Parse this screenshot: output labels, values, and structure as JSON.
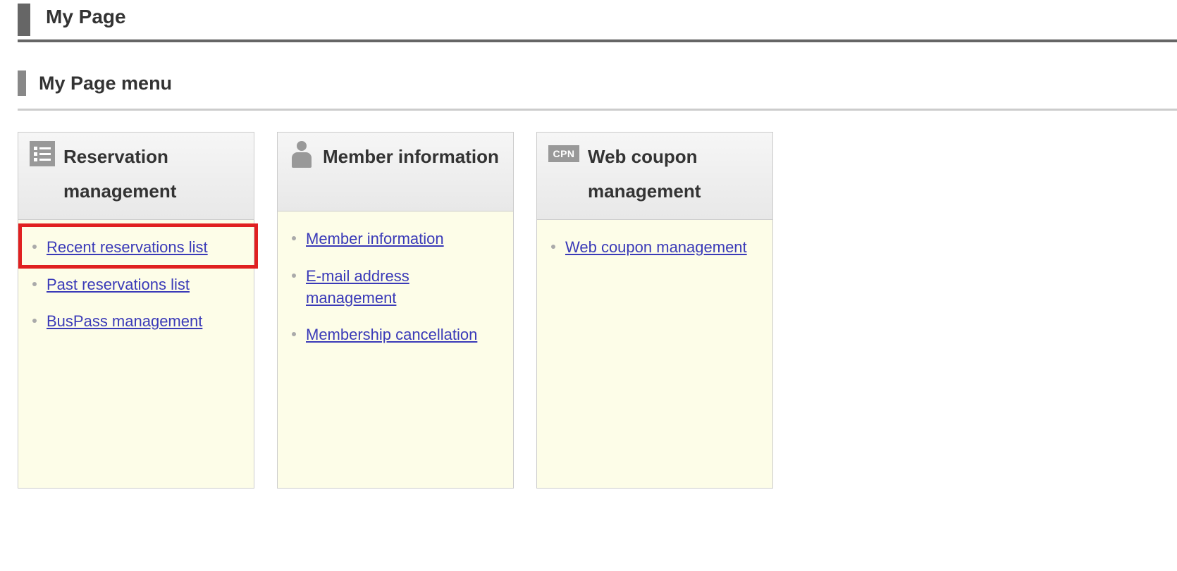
{
  "page": {
    "title": "My Page"
  },
  "section": {
    "title": "My Page menu"
  },
  "cards": [
    {
      "title": "Reservation management",
      "icon": "list-icon",
      "links": [
        {
          "label": "Recent reservations list",
          "highlighted": true
        },
        {
          "label": "Past reservations list"
        },
        {
          "label": "BusPass management"
        }
      ]
    },
    {
      "title": "Member information",
      "icon": "person-icon",
      "links": [
        {
          "label": "Member information"
        },
        {
          "label": "E-mail address management"
        },
        {
          "label": "Membership cancellation"
        }
      ]
    },
    {
      "title": "Web coupon management",
      "icon": "cpn-icon",
      "icon_text": "CPN",
      "links": [
        {
          "label": "Web coupon management"
        }
      ]
    }
  ]
}
